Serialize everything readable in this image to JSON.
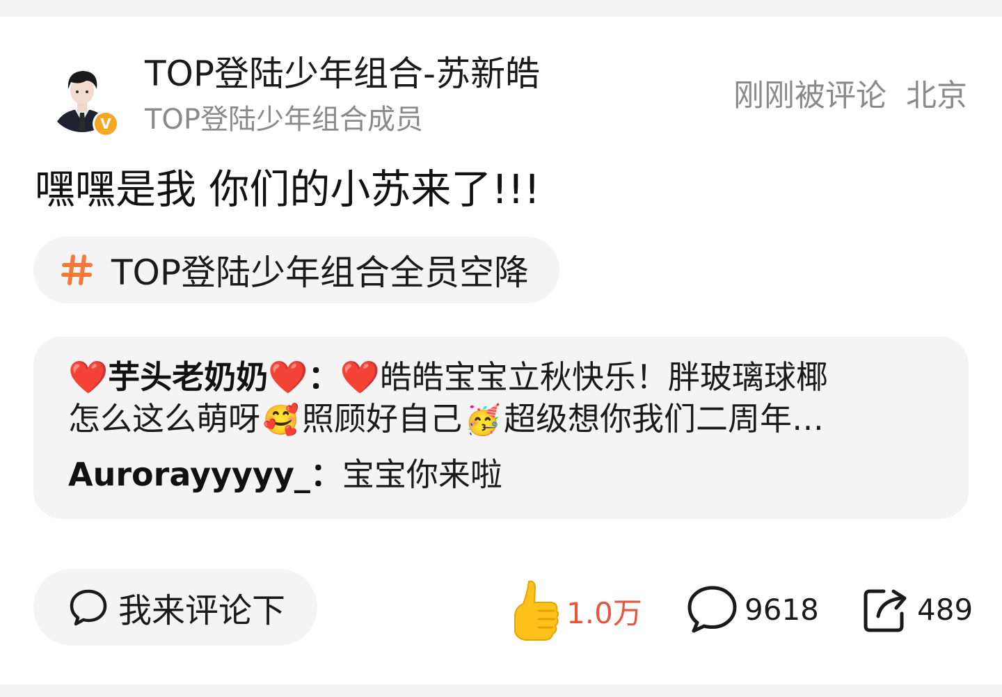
{
  "post": {
    "author_name": "TOP登陆少年组合-苏新皓",
    "author_desc": "TOP登陆少年组合成员",
    "time": "刚刚被评论",
    "location": "北京",
    "text": "嘿嘿是我 你们的小苏来了!!!",
    "topic": "TOP登陆少年组合全员空降",
    "verified_badge": "V"
  },
  "comments": [
    {
      "user": "❤️芋头老奶奶❤️",
      "separator": "：",
      "line1": "❤️皓皓宝宝立秋快乐！胖玻璃球椰",
      "line2_a": "怎么这么萌呀",
      "emoji_1": "🥰",
      "line2_b": "照顾好自己",
      "emoji_2": "🥳",
      "line2_c": "超级想你我们二周年…"
    },
    {
      "user": "Aurorayyyyy_",
      "separator": "：",
      "text": "宝宝你来啦"
    }
  ],
  "actions": {
    "comment_placeholder": "我来评论下",
    "likes": "1.0万",
    "comments": "9618",
    "reposts": "489"
  },
  "colors": {
    "like_count": "#e8553f",
    "topic_hash": "#f47a3a",
    "verified_badge": "#f5a623"
  },
  "icons": {
    "topic": "hash-icon",
    "comment_input": "speech-bubble-icon",
    "like": "thumbs-up-icon",
    "comment": "speech-bubble-icon",
    "repost": "share-icon"
  }
}
